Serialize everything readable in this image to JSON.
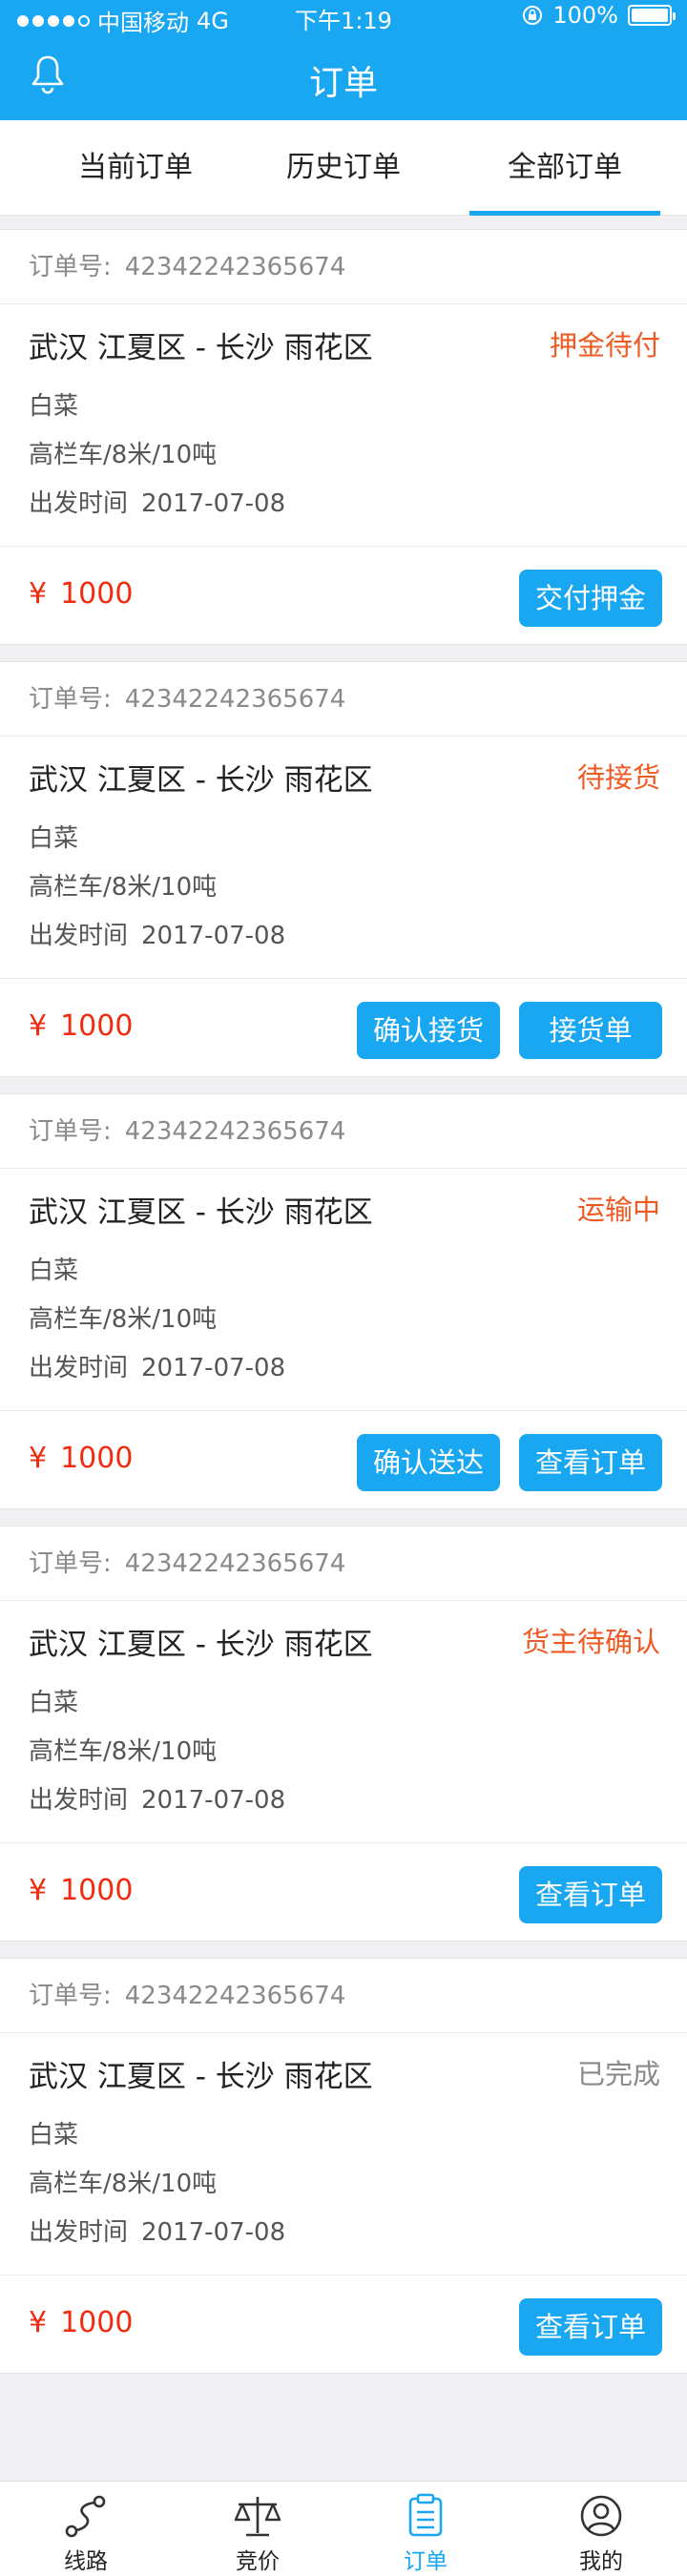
{
  "status_bar": {
    "carrier": "中国移动",
    "network": "4G",
    "time": "下午1:19",
    "battery": "100%"
  },
  "header": {
    "title": "订单",
    "bell_icon": "bell-icon"
  },
  "tabs": [
    {
      "label": "当前订单",
      "active": false
    },
    {
      "label": "历史订单",
      "active": false
    },
    {
      "label": "全部订单",
      "active": true
    }
  ],
  "orders": [
    {
      "order_no_label": "订单号:",
      "order_no": "42342242365674",
      "route": "武汉 江夏区 - 长沙 雨花区",
      "status": "押金待付",
      "cargo": "白菜",
      "vehicle": "高栏车/8米/10吨",
      "depart_label": "出发时间",
      "depart_date": "2017-07-08",
      "currency": "¥",
      "price": "1000",
      "buttons": [
        "交付押金"
      ]
    },
    {
      "order_no_label": "订单号:",
      "order_no": "42342242365674",
      "route": "武汉 江夏区 - 长沙 雨花区",
      "status": "待接货",
      "cargo": "白菜",
      "vehicle": "高栏车/8米/10吨",
      "depart_label": "出发时间",
      "depart_date": "2017-07-08",
      "currency": "¥",
      "price": "1000",
      "buttons": [
        "接货单",
        "确认接货"
      ]
    },
    {
      "order_no_label": "订单号:",
      "order_no": "42342242365674",
      "route": "武汉 江夏区 - 长沙 雨花区",
      "status": "运输中",
      "cargo": "白菜",
      "vehicle": "高栏车/8米/10吨",
      "depart_label": "出发时间",
      "depart_date": "2017-07-08",
      "currency": "¥",
      "price": "1000",
      "buttons": [
        "查看订单",
        "确认送达"
      ]
    },
    {
      "order_no_label": "订单号:",
      "order_no": "42342242365674",
      "route": "武汉 江夏区 - 长沙 雨花区",
      "status": "货主待确认",
      "cargo": "白菜",
      "vehicle": "高栏车/8米/10吨",
      "depart_label": "出发时间",
      "depart_date": "2017-07-08",
      "currency": "¥",
      "price": "1000",
      "buttons": [
        "查看订单"
      ]
    },
    {
      "order_no_label": "订单号:",
      "order_no": "42342242365674",
      "route": "武汉 江夏区 - 长沙 雨花区",
      "status": "已完成",
      "cargo": "白菜",
      "vehicle": "高栏车/8米/10吨",
      "depart_label": "出发时间",
      "depart_date": "2017-07-08",
      "currency": "¥",
      "price": "1000",
      "buttons": [
        "查看订单"
      ]
    }
  ],
  "tabbar": [
    {
      "label": "线路",
      "icon": "route-icon",
      "active": false
    },
    {
      "label": "竞价",
      "icon": "scale-icon",
      "active": false
    },
    {
      "label": "订单",
      "icon": "clipboard-icon",
      "active": true
    },
    {
      "label": "我的",
      "icon": "user-icon",
      "active": false
    }
  ],
  "colors": {
    "primary": "#1aa7f2",
    "status_orange": "#ef5a22",
    "price_red": "#ef2c0f",
    "done_gray": "#8a8a8a"
  }
}
